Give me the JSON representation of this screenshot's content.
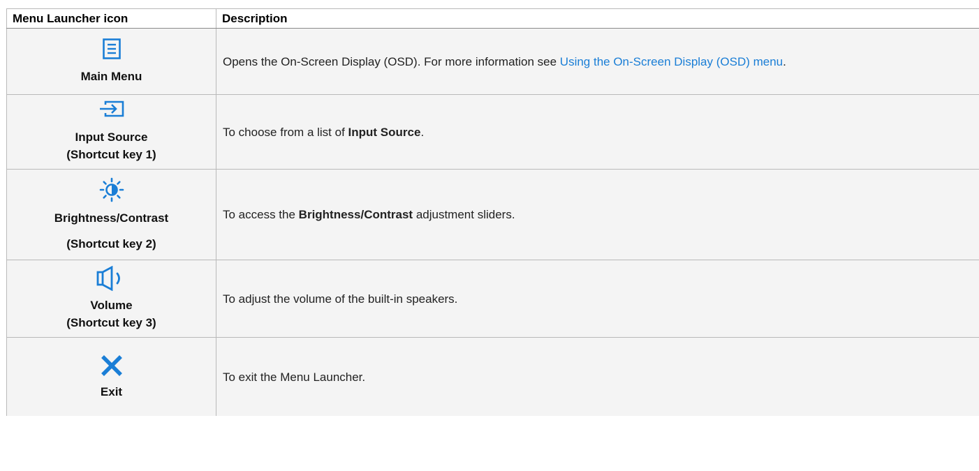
{
  "accent_color": "#1a7ed6",
  "header": {
    "col1": "Menu Launcher icon",
    "col2": "Description"
  },
  "rows": [
    {
      "icon": "main-menu-icon",
      "label": "Main Menu",
      "desc_prefix": "Opens the On-Screen Display (OSD). For more information see ",
      "desc_link": "Using the On-Screen Display (OSD) menu",
      "desc_suffix": "."
    },
    {
      "icon": "input-source-icon",
      "label": "Input Source",
      "sublabel": "(Shortcut key 1)",
      "desc_prefix": "To choose from a list of ",
      "desc_bold": "Input Source",
      "desc_suffix": "."
    },
    {
      "icon": "brightness-icon",
      "label": "Brightness/Contrast",
      "sublabel": "(Shortcut key 2)",
      "desc_prefix": "To access the ",
      "desc_bold": "Brightness/Contrast",
      "desc_suffix": " adjustment sliders."
    },
    {
      "icon": "volume-icon",
      "label": "Volume",
      "sublabel": "(Shortcut key 3)",
      "desc": "To adjust the volume of the built-in speakers."
    },
    {
      "icon": "close-icon",
      "label": "Exit",
      "desc": "To exit the Menu Launcher."
    }
  ]
}
